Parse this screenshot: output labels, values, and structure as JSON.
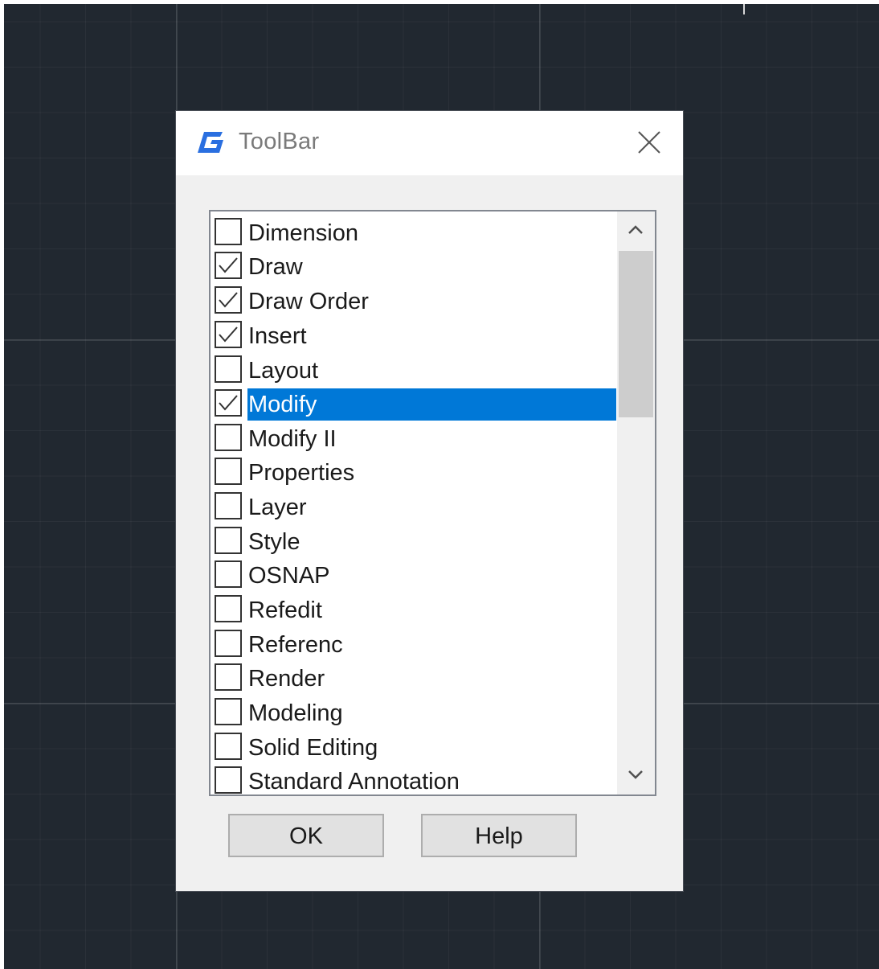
{
  "dialog": {
    "title": "ToolBar",
    "icon": "gstarcad-g-icon",
    "close_icon": "close-icon"
  },
  "toolbar_list": {
    "selected_index": 5,
    "items": [
      {
        "label": "Dimension",
        "checked": false
      },
      {
        "label": "Draw",
        "checked": true
      },
      {
        "label": "Draw Order",
        "checked": true
      },
      {
        "label": "Insert",
        "checked": true
      },
      {
        "label": "Layout",
        "checked": false
      },
      {
        "label": "Modify",
        "checked": true
      },
      {
        "label": "Modify II",
        "checked": false
      },
      {
        "label": "Properties",
        "checked": false
      },
      {
        "label": "Layer",
        "checked": false
      },
      {
        "label": "Style",
        "checked": false
      },
      {
        "label": "OSNAP",
        "checked": false
      },
      {
        "label": "Refedit",
        "checked": false
      },
      {
        "label": "Referenc",
        "checked": false
      },
      {
        "label": "Render",
        "checked": false
      },
      {
        "label": "Modeling",
        "checked": false
      },
      {
        "label": "Solid Editing",
        "checked": false
      },
      {
        "label": "Standard Annotation",
        "checked": false
      }
    ]
  },
  "buttons": {
    "ok_label": "OK",
    "help_label": "Help"
  },
  "colors": {
    "canvas_background": "#212830",
    "selection": "#0078d7",
    "app_icon_blue": "#2a6fe0"
  }
}
